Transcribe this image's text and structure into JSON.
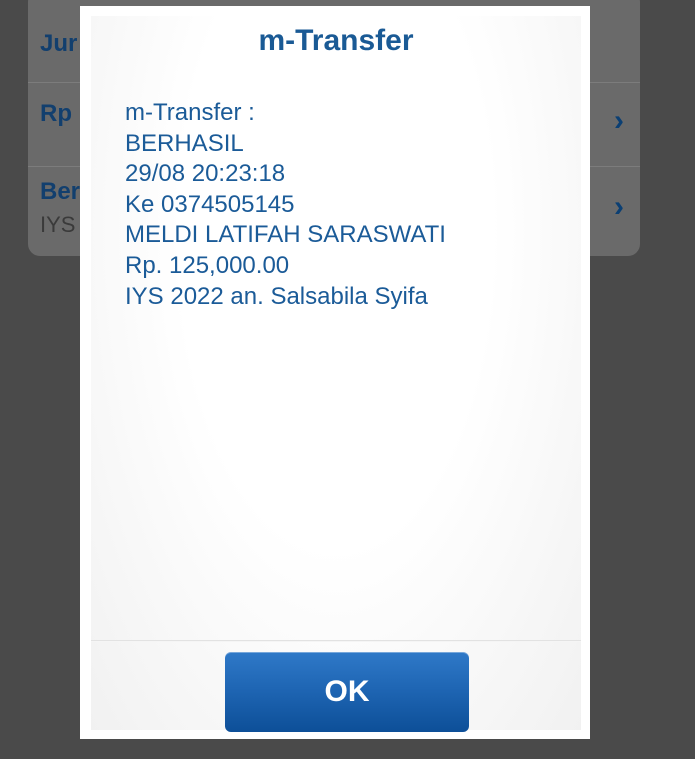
{
  "background_list": {
    "rows": [
      {
        "label": "Jur",
        "sub": ""
      },
      {
        "label": "Rp",
        "sub": ""
      },
      {
        "label": "Ber",
        "sub": "IYS"
      }
    ]
  },
  "dialog": {
    "title": "m-Transfer",
    "message_lines": [
      "m-Transfer :",
      "BERHASIL",
      "29/08 20:23:18",
      "Ke 0374505145",
      "MELDI LATIFAH SARASWATI",
      "Rp. 125,000.00",
      "IYS 2022 an. Salsabila Syifa"
    ],
    "ok_label": "OK"
  },
  "colors": {
    "title": "#1a5a95",
    "message_text": "#1b5b98",
    "button": "#1f66b4",
    "overlay": "#4a4a4a"
  },
  "icons": [
    "chevron-right-icon"
  ]
}
